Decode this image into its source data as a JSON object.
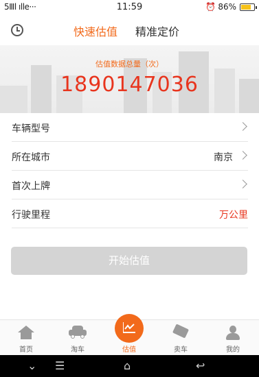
{
  "status_bar": {
    "left_indicators": "5Ⅲl ılle···",
    "time": "11:59",
    "battery_percent": "86%"
  },
  "header": {
    "history_icon": "history-clock-icon",
    "tabs": [
      {
        "label": "快速估值",
        "active": true
      },
      {
        "label": "精准定价",
        "active": false
      }
    ]
  },
  "hero": {
    "label": "估值数据总量（次）",
    "count": "1890147036"
  },
  "form": {
    "rows": [
      {
        "label": "车辆型号",
        "value": "",
        "chevron": true
      },
      {
        "label": "所在城市",
        "value": "南京",
        "chevron": true
      },
      {
        "label": "首次上牌",
        "value": "",
        "chevron": true
      },
      {
        "label": "行驶里程",
        "value": "万公里",
        "chevron": false
      }
    ]
  },
  "start_button": {
    "label": "开始估值"
  },
  "bottom_nav": {
    "items": [
      {
        "label": "首页",
        "icon": "home-icon"
      },
      {
        "label": "淘车",
        "icon": "car-icon"
      },
      {
        "label": "估值",
        "icon": "chart-icon",
        "active": true
      },
      {
        "label": "卖车",
        "icon": "tag-icon"
      },
      {
        "label": "我的",
        "icon": "user-icon"
      }
    ]
  },
  "colors": {
    "accent": "#f26a1b",
    "count_red": "#e8351e",
    "button_disabled": "#d4d4d4"
  }
}
